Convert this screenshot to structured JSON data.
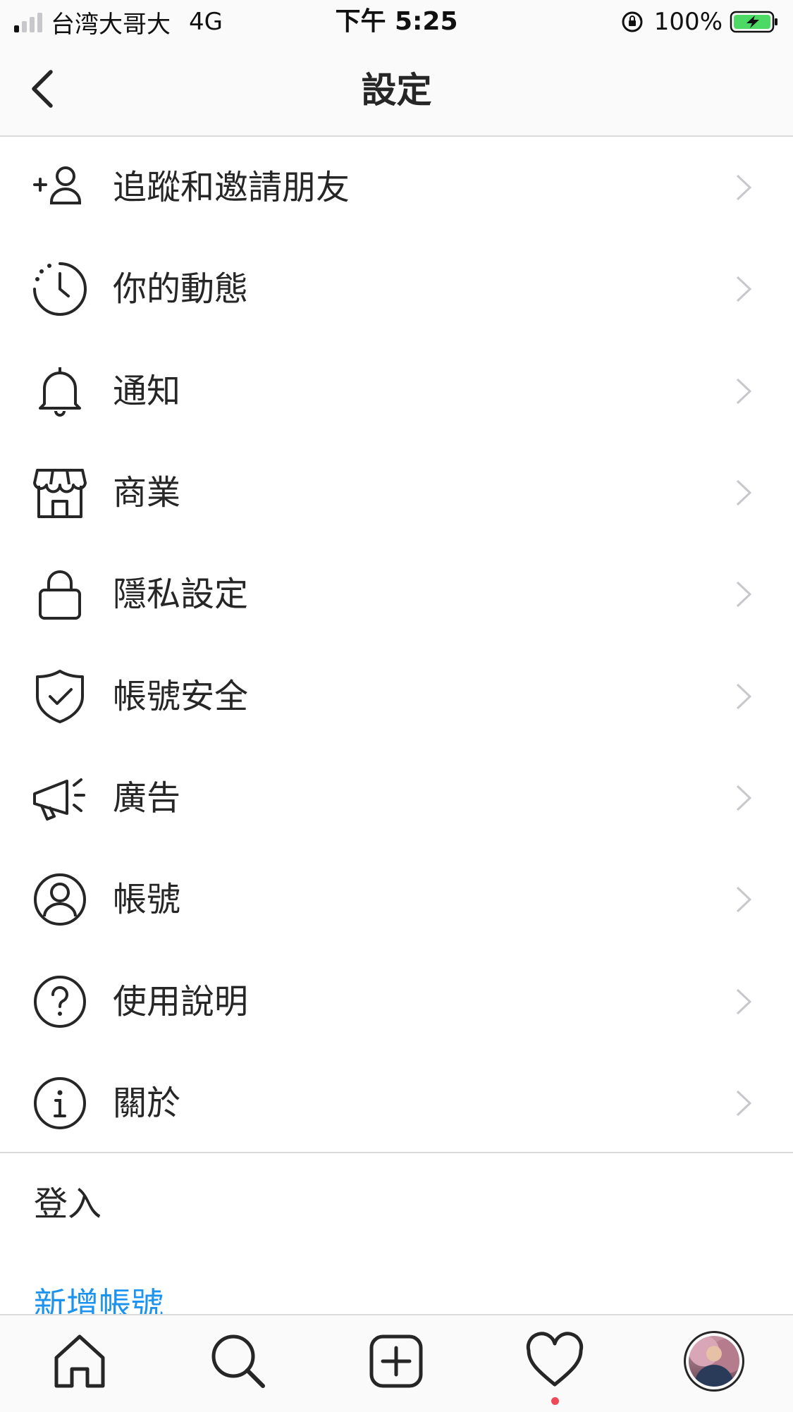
{
  "status_bar": {
    "carrier": "台湾大哥大",
    "network": "4G",
    "time": "下午 5:25",
    "battery_percent": "100%",
    "signal_bars_active": 1,
    "signal_bars_total": 4,
    "battery_level": 1.0,
    "battery_color": "#4cd964"
  },
  "header": {
    "title": "設定",
    "back_icon": "chevron-left-icon"
  },
  "settings_items": [
    {
      "label": "追蹤和邀請朋友",
      "icon": "add-person-icon"
    },
    {
      "label": "你的動態",
      "icon": "activity-clock-icon"
    },
    {
      "label": "通知",
      "icon": "bell-icon"
    },
    {
      "label": "商業",
      "icon": "shop-icon"
    },
    {
      "label": "隱私設定",
      "icon": "lock-icon"
    },
    {
      "label": "帳號安全",
      "icon": "shield-check-icon"
    },
    {
      "label": "廣告",
      "icon": "megaphone-icon"
    },
    {
      "label": "帳號",
      "icon": "account-circle-icon"
    },
    {
      "label": "使用說明",
      "icon": "help-icon"
    },
    {
      "label": "關於",
      "icon": "info-icon"
    }
  ],
  "login": {
    "heading": "登入",
    "add_account": "新增帳號"
  },
  "tab_bar": {
    "tabs": [
      "home-icon",
      "search-icon",
      "new-post-icon",
      "heart-icon",
      "profile-avatar"
    ],
    "activity_dot_color": "#ed4956"
  },
  "colors": {
    "link": "#1d93f0",
    "text": "#262626",
    "chevron": "#c7c7cc"
  }
}
